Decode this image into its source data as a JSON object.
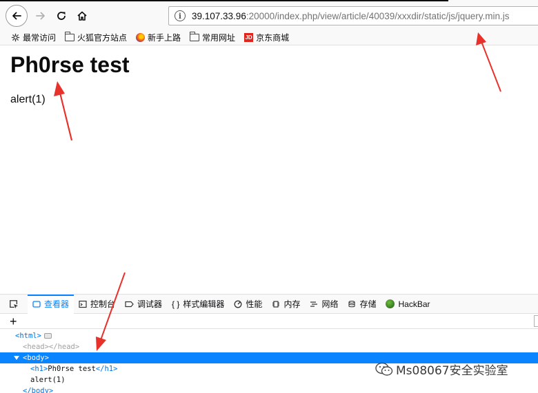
{
  "browser": {
    "url_host": "39.107.33.96",
    "url_path": ":20000/index.php/view/article/40039/xxxdir/static/js/jquery.min.js",
    "info_glyph": "i",
    "bookmarks": [
      {
        "label": "最常访问",
        "icon": "gear-icon"
      },
      {
        "label": "火狐官方站点",
        "icon": "folder-icon"
      },
      {
        "label": "新手上路",
        "icon": "firefox-icon"
      },
      {
        "label": "常用网址",
        "icon": "folder-icon"
      },
      {
        "label": "京东商城",
        "icon": "jd-icon",
        "icon_text": "JD"
      }
    ]
  },
  "page": {
    "title": "Ph0rse test",
    "body_text": "alert(1)"
  },
  "devtools": {
    "tabs": [
      {
        "label": "查看器",
        "icon": "inspector-icon",
        "selected": true
      },
      {
        "label": "控制台",
        "icon": "console-icon"
      },
      {
        "label": "调试器",
        "icon": "debugger-icon"
      },
      {
        "label": "样式编辑器",
        "icon": "style-editor-icon",
        "icon_glyph": "{ }"
      },
      {
        "label": "性能",
        "icon": "performance-icon"
      },
      {
        "label": "内存",
        "icon": "memory-icon"
      },
      {
        "label": "网络",
        "icon": "network-icon"
      },
      {
        "label": "存储",
        "icon": "storage-icon"
      },
      {
        "label": "HackBar",
        "icon": "hackbar-icon"
      }
    ],
    "add_node": "+",
    "tree": {
      "html_open": "<html>",
      "head": "<head></head>",
      "body_open": "<body>",
      "h1_open": "<h1>",
      "h1_text": "Ph0rse test",
      "h1_close": "</h1>",
      "body_text": "alert(1)",
      "body_close": "</body>"
    }
  },
  "watermark": {
    "text": "Ms08067安全实验室"
  },
  "colors": {
    "accent": "#0a84ff",
    "arrow": "#e8312a",
    "tag": "#0074e8"
  }
}
